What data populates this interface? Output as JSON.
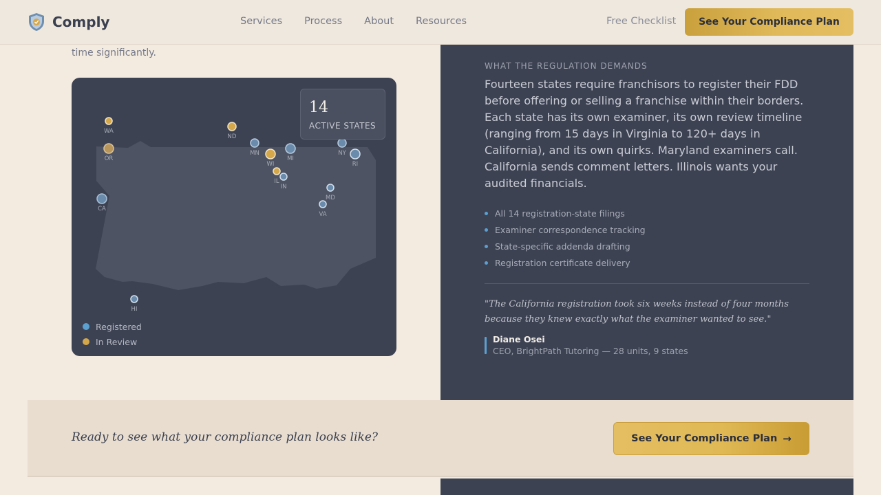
{
  "nav": {
    "logo_text": "Comply",
    "links": [
      "Services",
      "Process",
      "About",
      "Resources"
    ],
    "free_link": "Free Checklist",
    "cta_label": "See Your Compliance Plan"
  },
  "left": {
    "intro_tail": "time significantly.",
    "map": {
      "stat_number": "14",
      "stat_label": "ACTIVE STATES",
      "legend": [
        {
          "label": "Registered",
          "color": "#5ba0d0"
        },
        {
          "label": "In Review",
          "color": "#d4a84a"
        }
      ],
      "states": [
        "WA",
        "OR",
        "CA",
        "ND",
        "MN",
        "WI",
        "MI",
        "IL",
        "IN",
        "NY",
        "RI",
        "MD",
        "VA",
        "HI"
      ]
    }
  },
  "right": {
    "eyebrow": "WHAT THE REGULATION DEMANDS",
    "body": "Fourteen states require franchisors to register their FDD before offering or selling a franchise within their borders. Each state has its own examiner, its own review timeline (ranging from 15 days in Virginia to 120+ days in California), and its own quirks. Maryland examiners call. California sends comment letters. Illinois wants your audited financials.",
    "bullets": [
      "All 14 registration-state filings",
      "Examiner correspondence tracking",
      "State-specific addenda drafting",
      "Registration certificate delivery"
    ],
    "quote": "\"The California registration took six weeks instead of four months because they knew exactly what the examiner wanted to see.\"",
    "author_name": "Diane Osei",
    "author_role": "CEO, BrightPath Tutoring — 28 units, 9 states"
  },
  "cta": {
    "text": "Ready to see what your compliance plan looks like?",
    "button_label": "See Your Compliance Plan"
  },
  "colors": {
    "registered": "#5ba0d0",
    "in_review": "#d4a84a",
    "dark_panel": "#3d4253",
    "gold": "#e0b955"
  },
  "icons": {
    "logo": "shield-icon",
    "cta_arrow": "arrow-right-icon"
  }
}
